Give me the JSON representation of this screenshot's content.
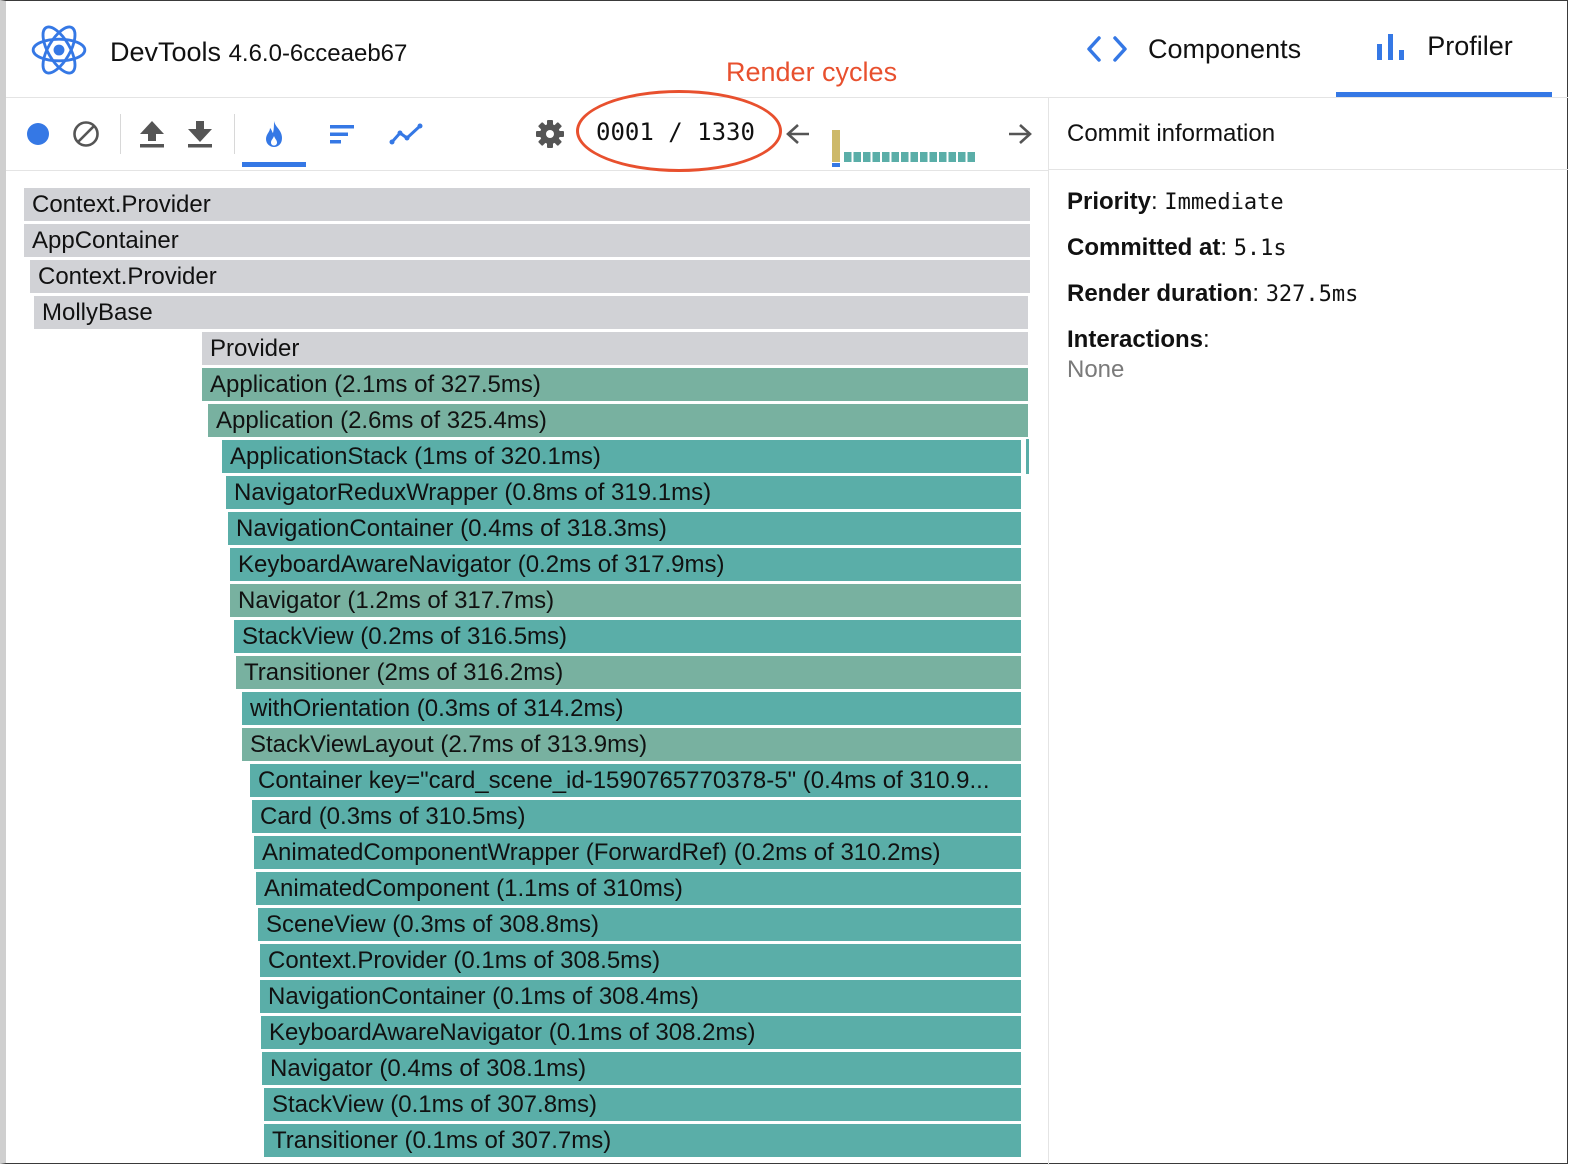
{
  "app": {
    "name": "DevTools",
    "version": "4.6.0-6cceaeb67"
  },
  "annotation": {
    "label": "Render cycles",
    "color": "#e8502e"
  },
  "tabs": {
    "components": {
      "label": "Components",
      "icon": "code-brackets-icon"
    },
    "profiler": {
      "label": "Profiler",
      "icon": "bar-chart-icon",
      "active": true
    }
  },
  "toolbar": {
    "buttons": [
      "record-button",
      "clear-button",
      "load-profile-button",
      "save-profile-button",
      "flamegraph-button",
      "ranked-button",
      "interactions-button",
      "settings-button"
    ],
    "selected_view": "flamegraph",
    "commit_counter": "0001 / 1330",
    "prev_icon": "arrow-left-icon",
    "next_icon": "arrow-right-icon"
  },
  "colors": {
    "accent": "#3578e5",
    "bar_gray": "#d1d2d6",
    "bar_green": "#78b1a0",
    "bar_teal": "#5aaea8",
    "commit_selected": "#cdb96a"
  },
  "commit_info": {
    "header": "Commit information",
    "priority_label": "Priority",
    "priority_value": "Immediate",
    "committed_at_label": "Committed at",
    "committed_at_value": "5.1s",
    "render_duration_label": "Render duration",
    "render_duration_value": "327.5ms",
    "interactions_label": "Interactions",
    "interactions_value": "None"
  },
  "flame": [
    {
      "label": "Context.Provider",
      "kind": "gray"
    },
    {
      "label": "AppContainer",
      "kind": "gray"
    },
    {
      "label": "Context.Provider",
      "kind": "gray"
    },
    {
      "label": "MollyBase",
      "kind": "gray"
    },
    {
      "label": "Provider",
      "kind": "gray"
    },
    {
      "label": "Application (2.1ms of 327.5ms)",
      "kind": "green"
    },
    {
      "label": "Application (2.6ms of 325.4ms)",
      "kind": "green"
    },
    {
      "label": "ApplicationStack (1ms of 320.1ms)",
      "kind": "teal"
    },
    {
      "label": "NavigatorReduxWrapper (0.8ms of 319.1ms)",
      "kind": "teal"
    },
    {
      "label": "NavigationContainer (0.4ms of 318.3ms)",
      "kind": "teal"
    },
    {
      "label": "KeyboardAwareNavigator (0.2ms of 317.9ms)",
      "kind": "teal"
    },
    {
      "label": "Navigator (1.2ms of 317.7ms)",
      "kind": "green"
    },
    {
      "label": "StackView (0.2ms of 316.5ms)",
      "kind": "teal"
    },
    {
      "label": "Transitioner (2ms of 316.2ms)",
      "kind": "green"
    },
    {
      "label": "withOrientation (0.3ms of 314.2ms)",
      "kind": "teal"
    },
    {
      "label": "StackViewLayout (2.7ms of 313.9ms)",
      "kind": "green"
    },
    {
      "label": "Container key=\"card_scene_id-1590765770378-5\" (0.4ms of 310.9...",
      "kind": "teal"
    },
    {
      "label": "Card (0.3ms of 310.5ms)",
      "kind": "teal"
    },
    {
      "label": "AnimatedComponentWrapper (ForwardRef) (0.2ms of 310.2ms)",
      "kind": "teal"
    },
    {
      "label": "AnimatedComponent (1.1ms of 310ms)",
      "kind": "teal"
    },
    {
      "label": "SceneView (0.3ms of 308.8ms)",
      "kind": "teal"
    },
    {
      "label": "Context.Provider (0.1ms of 308.5ms)",
      "kind": "teal"
    },
    {
      "label": "NavigationContainer (0.1ms of 308.4ms)",
      "kind": "teal"
    },
    {
      "label": "KeyboardAwareNavigator (0.1ms of 308.2ms)",
      "kind": "teal"
    },
    {
      "label": "Navigator (0.4ms of 308.1ms)",
      "kind": "teal"
    },
    {
      "label": "StackView (0.1ms of 307.8ms)",
      "kind": "teal"
    },
    {
      "label": "Transitioner (0.1ms of 307.7ms)",
      "kind": "teal"
    }
  ]
}
